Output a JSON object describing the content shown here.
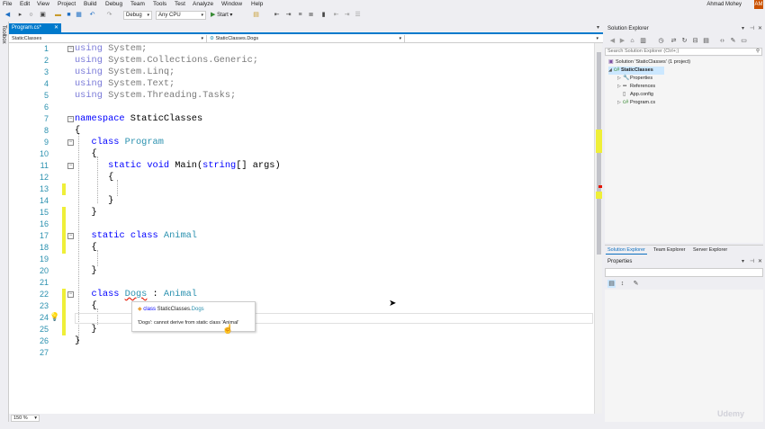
{
  "menu": [
    "File",
    "Edit",
    "View",
    "Project",
    "Build",
    "Debug",
    "Team",
    "Tools",
    "Test",
    "Analyze",
    "Window",
    "Help"
  ],
  "user": {
    "name": "Ahmad Mohey",
    "initials": "AM"
  },
  "toolbar": {
    "config": "Debug",
    "platform": "Any CPU",
    "start_label": "Start"
  },
  "toolbox_label": "Toolbox",
  "editor": {
    "tab_label": "Program.cs*",
    "nav_project": "StaticClasses",
    "nav_type": "StaticClasses.Dogs",
    "nav_member": "",
    "zoom": "150 %",
    "lines": [
      {
        "n": "1",
        "text": "using System;"
      },
      {
        "n": "2",
        "text": "using System.Collections.Generic;"
      },
      {
        "n": "3",
        "text": "using System.Linq;"
      },
      {
        "n": "4",
        "text": "using System.Text;"
      },
      {
        "n": "5",
        "text": "using System.Threading.Tasks;"
      },
      {
        "n": "6",
        "text": ""
      },
      {
        "n": "7",
        "text": "namespace StaticClasses"
      },
      {
        "n": "8",
        "text": "{"
      },
      {
        "n": "9",
        "text": "class Program"
      },
      {
        "n": "10",
        "text": "{"
      },
      {
        "n": "11",
        "text": "static void Main(string[] args)"
      },
      {
        "n": "12",
        "text": "{"
      },
      {
        "n": "13",
        "text": ""
      },
      {
        "n": "14",
        "text": "}"
      },
      {
        "n": "15",
        "text": "}"
      },
      {
        "n": "16",
        "text": ""
      },
      {
        "n": "17",
        "text": "static class Animal"
      },
      {
        "n": "18",
        "text": "{"
      },
      {
        "n": "19",
        "text": ""
      },
      {
        "n": "20",
        "text": "}"
      },
      {
        "n": "21",
        "text": ""
      },
      {
        "n": "22",
        "text": "class Dogs : Animal"
      },
      {
        "n": "23",
        "text": "{"
      },
      {
        "n": "24",
        "text": ""
      },
      {
        "n": "25",
        "text": "}"
      },
      {
        "n": "26",
        "text": "}"
      },
      {
        "n": "27",
        "text": ""
      }
    ],
    "tooltip": {
      "keyword": "class",
      "namespace": "StaticClasses.",
      "type": "Dogs",
      "error": "'Dogs': cannot derive from static class 'Animal'"
    }
  },
  "solution_explorer": {
    "title": "Solution Explorer",
    "search_placeholder": "Search Solution Explorer (Ctrl+;)",
    "tree": [
      {
        "label": "Solution 'StaticClasses' (1 project)",
        "level": 0
      },
      {
        "label": "StaticClasses",
        "level": 1,
        "selected": true
      },
      {
        "label": "Properties",
        "level": 2
      },
      {
        "label": "References",
        "level": 2
      },
      {
        "label": "App.config",
        "level": 2
      },
      {
        "label": "Program.cs",
        "level": 2
      }
    ],
    "tabs": [
      "Solution Explorer",
      "Team Explorer",
      "Server Explorer"
    ]
  },
  "properties": {
    "title": "Properties"
  },
  "colors": {
    "accent": "#007acc",
    "keyword": "#0000ff",
    "type": "#2b91af",
    "change": "#efef38"
  },
  "watermark": "Udemy"
}
